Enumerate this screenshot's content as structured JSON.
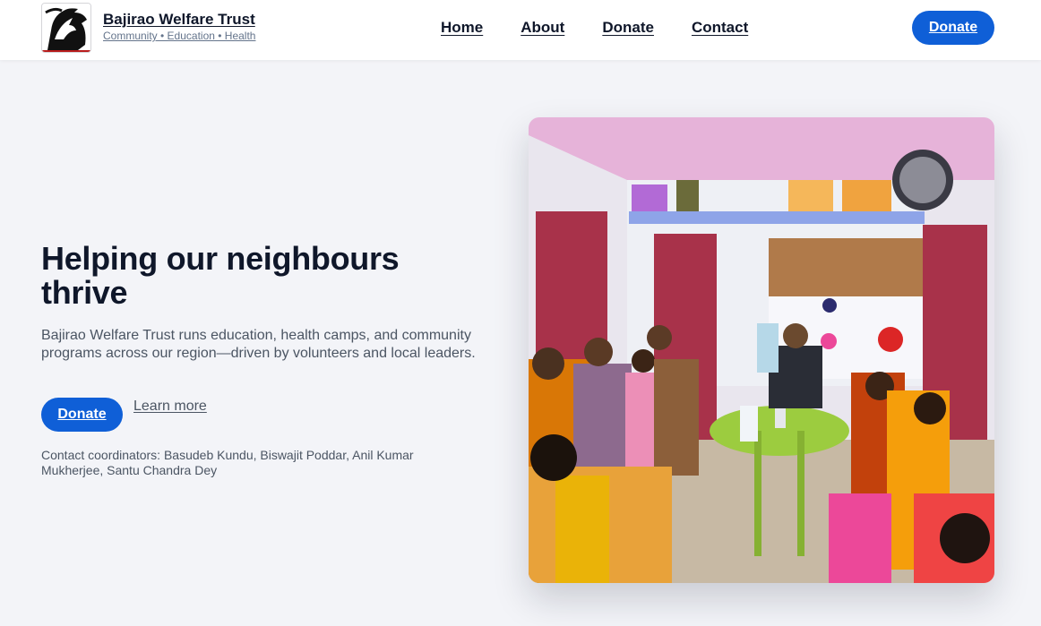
{
  "brand": {
    "name": "Bajirao Welfare Trust",
    "tagline": "Community • Education • Health"
  },
  "nav": {
    "items": [
      "Home",
      "About",
      "Donate",
      "Contact"
    ],
    "cta_label": "Donate"
  },
  "hero": {
    "title": "Helping our neighbours thrive",
    "description": "Bajirao Welfare Trust runs education, health camps, and community programs across our region—driven by volunteers and local leaders.",
    "primary_button": "Donate",
    "secondary_link": "Learn more",
    "contacts": "Contact coordinators: Basudeb Kundu, Biswajit Poddar, Anil Kumar Mukherjee, Santu Chandra Dey"
  },
  "colors": {
    "accent": "#0f5fd7",
    "background": "#f3f4f8",
    "text": "#0f172a"
  }
}
